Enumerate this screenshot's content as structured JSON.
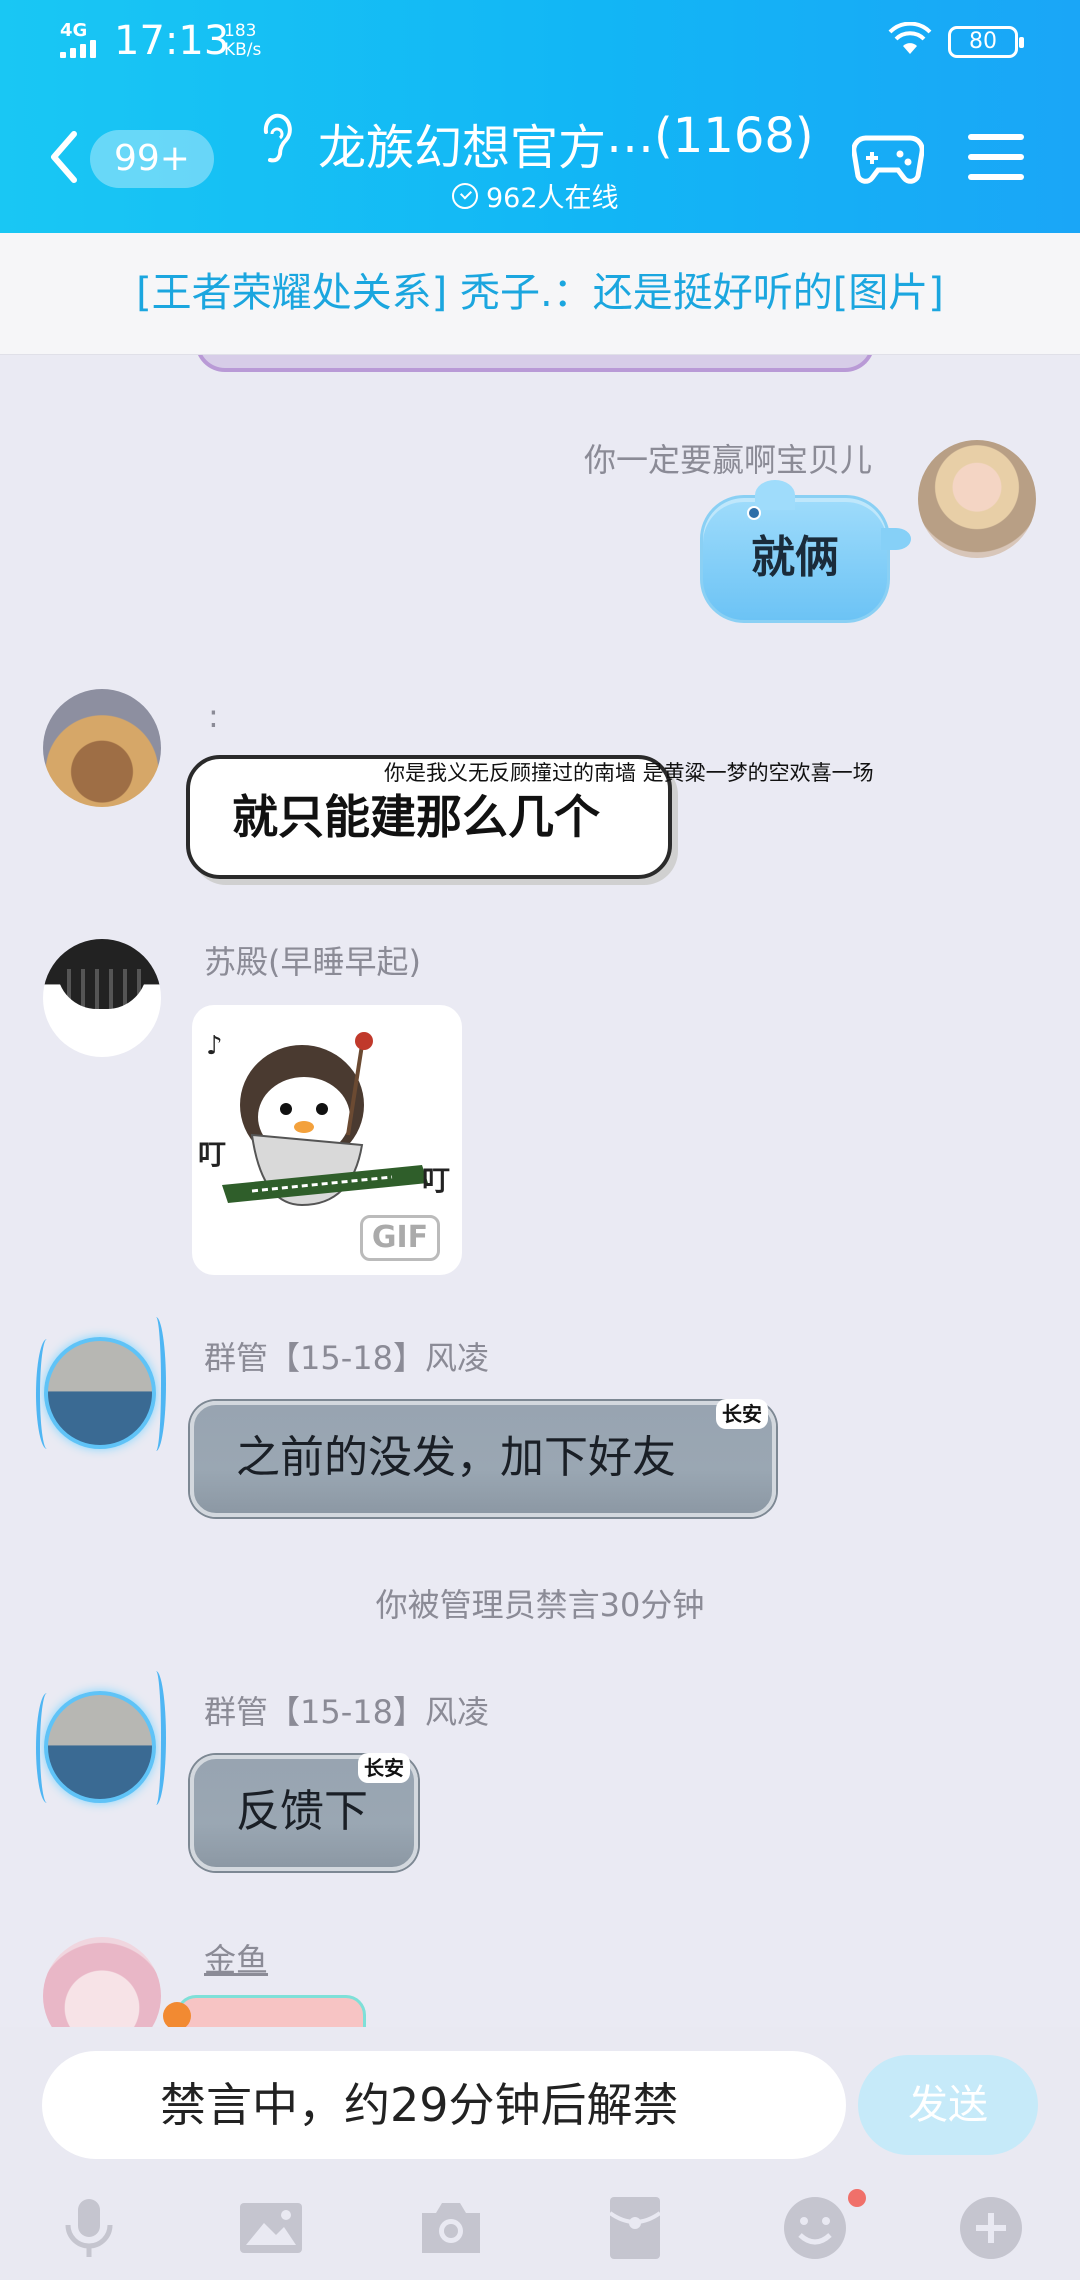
{
  "status_bar": {
    "network": "4G",
    "time": "17:13",
    "speed_value": "183",
    "speed_unit": "KB/s",
    "battery": "80"
  },
  "nav": {
    "unread_badge": "99+",
    "group_name": "龙族幻想官方",
    "ellipsis": "…",
    "member_count": "(1168)",
    "online": "962人在线"
  },
  "pinned_notice": "[王者荣耀处关系] 秃子.：还是挺好听的[图片]",
  "messages": [
    {
      "sender": "你一定要赢啊宝贝儿",
      "text": "就俩"
    },
    {
      "sender": ":",
      "signature": "你是我义无反顾撞过的南墙  是黄粱一梦的空欢喜一场",
      "text": "就只能建那么几个"
    },
    {
      "sender": "苏殿(早睡早起)",
      "sticker_badge": "GIF",
      "sticker_text_1": "叮",
      "sticker_text_2": "叮"
    },
    {
      "sender": "群管【15-18】风凌",
      "tag": "长安",
      "text": "之前的没发，加下好友"
    },
    {
      "sender": "群管【15-18】风凌",
      "tag": "长安",
      "text": "反馈下"
    },
    {
      "sender": "金鱼"
    }
  ],
  "system_message": "你被管理员禁言30分钟",
  "input": {
    "mute_text": "禁言中，约29分钟后解禁",
    "send_label": "发送"
  },
  "toolbar": [
    "microphone-icon",
    "image-icon",
    "camera-icon",
    "red-packet-icon",
    "emoji-icon",
    "plus-icon"
  ],
  "colors": {
    "header": "#12b6f5",
    "notice_text": "#1ba6df",
    "background": "#eaeaf3",
    "send_disabled": "#c6eaf9"
  }
}
